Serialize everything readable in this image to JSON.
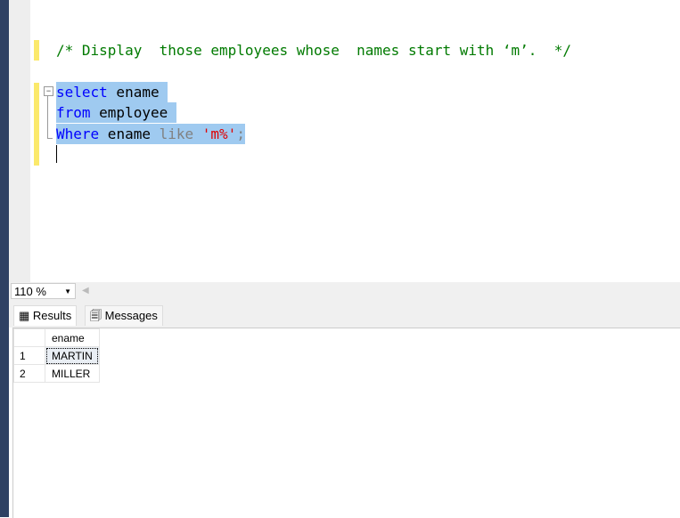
{
  "editor": {
    "comment": "/* Display  those employees whose  names start with ‘m’.  */",
    "line1": {
      "kw": "select",
      "rest": " ename "
    },
    "line2": {
      "kw": "from",
      "rest": " employee "
    },
    "line3": {
      "kw": "Where",
      "id": " ename ",
      "op": "like",
      "sp": " ",
      "str": "'m%'",
      "end": ";"
    }
  },
  "zoom": {
    "value": "110 %"
  },
  "tabs": [
    {
      "label": "Results"
    },
    {
      "label": "Messages"
    }
  ],
  "results": {
    "columns": [
      "ename"
    ],
    "rows": [
      {
        "n": "1",
        "ename": "MARTIN"
      },
      {
        "n": "2",
        "ename": "MILLER"
      }
    ]
  }
}
